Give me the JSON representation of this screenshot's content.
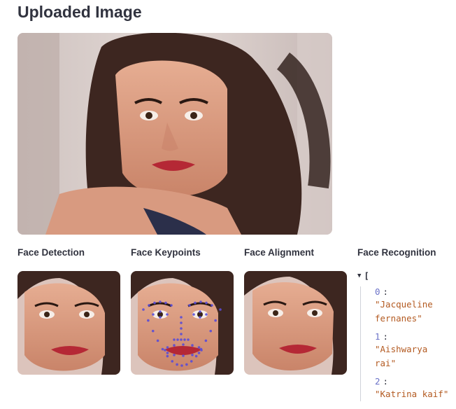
{
  "page": {
    "title": "Uploaded Image"
  },
  "columns": [
    {
      "label": "Face Detection"
    },
    {
      "label": "Face Keypoints"
    },
    {
      "label": "Face Alignment"
    },
    {
      "label": "Face Recognition"
    }
  ],
  "recognition": {
    "open_bracket": "[",
    "items": [
      {
        "index": "0",
        "line1": "\"Jacqueline",
        "line2": "fernanes\""
      },
      {
        "index": "1",
        "line1": "\"Aishwarya",
        "line2": "rai\""
      },
      {
        "index": "2",
        "line1": "\"Katrina kaif\"",
        "line2": ""
      }
    ]
  },
  "colors": {
    "text": "#31333f",
    "index": "#6b72c8",
    "string": "#b35a21",
    "keypoint": "#5a4cd6"
  }
}
